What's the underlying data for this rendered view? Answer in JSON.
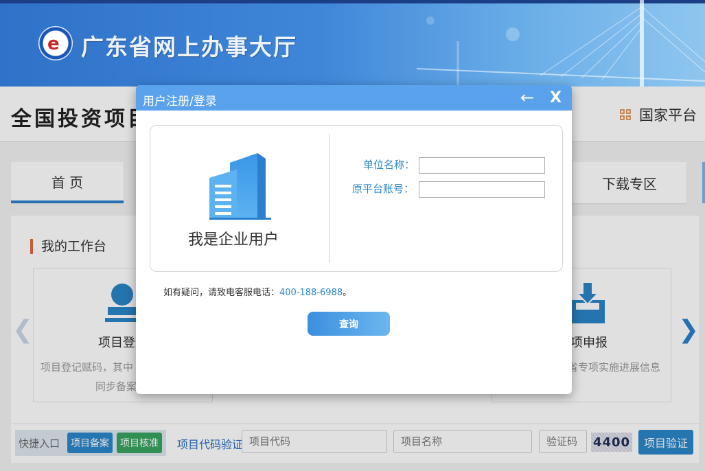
{
  "banner": {
    "site_title": "广东省网上办事大厅"
  },
  "header": {
    "page_title": "全国投资项目",
    "national_platform": "国家平台"
  },
  "tabs": {
    "home": "首 页",
    "download": "下载专区"
  },
  "workbench": {
    "title": "我的工作台",
    "cards": [
      {
        "title": "项目登记",
        "desc_line1": "项目登记赋码，其中",
        "desc_line2": "同步备案"
      },
      {
        "title": "项申报",
        "desc_line1": "省专项实施进展信息"
      }
    ]
  },
  "quickbar": {
    "label": "快捷入口",
    "btn_record": "项目备案",
    "btn_approve": "项目核准",
    "verify_label": "项目代码验证",
    "code_placeholder": "项目代码",
    "name_placeholder": "项目名称",
    "captcha_placeholder": "验证码",
    "captcha_text": "4400",
    "verify_button": "项目验证"
  },
  "modal": {
    "title": "用户注册/登录",
    "back_symbol": "←",
    "close_symbol": "X",
    "enterprise_label": "我是企业用户",
    "field_unit_label": "单位名称：",
    "field_account_label": "原平台账号：",
    "field_unit_value": "",
    "field_account_value": "",
    "help_text": "如有疑问，请致电客服电话：",
    "help_phone": "400-188-6988",
    "help_end": "。",
    "query_button": "查询"
  },
  "colors": {
    "accent": "#2a84c8",
    "header_blue": "#5aa2ec",
    "green": "#3aa35f"
  }
}
